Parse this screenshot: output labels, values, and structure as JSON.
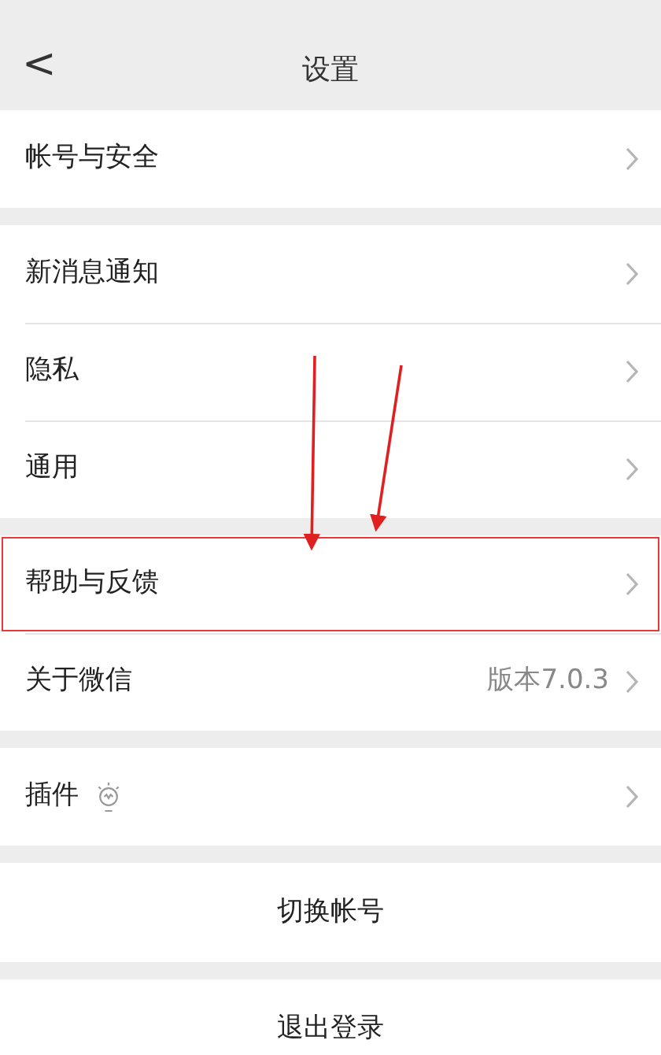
{
  "nav_bar": {
    "back": "<",
    "title": "设置"
  },
  "groups": [
    {
      "items": [
        {
          "label": "帐号与安全",
          "kind": "nav",
          "highlighted": false
        }
      ]
    },
    {
      "items": [
        {
          "label": "新消息通知",
          "kind": "nav",
          "highlighted": false
        },
        {
          "label": "隐私",
          "kind": "nav",
          "highlighted": false
        },
        {
          "label": "通用",
          "kind": "nav",
          "highlighted": false
        }
      ]
    },
    {
      "items": [
        {
          "label": "帮助与反馈",
          "kind": "nav",
          "highlighted": true
        },
        {
          "label": "关于微信",
          "kind": "nav",
          "value": "版本7.0.3",
          "highlighted": false
        }
      ]
    },
    {
      "items": [
        {
          "label": "插件",
          "kind": "nav-bulb",
          "highlighted": false
        }
      ]
    }
  ],
  "actions": [
    "切换帐号",
    "退出登录"
  ]
}
